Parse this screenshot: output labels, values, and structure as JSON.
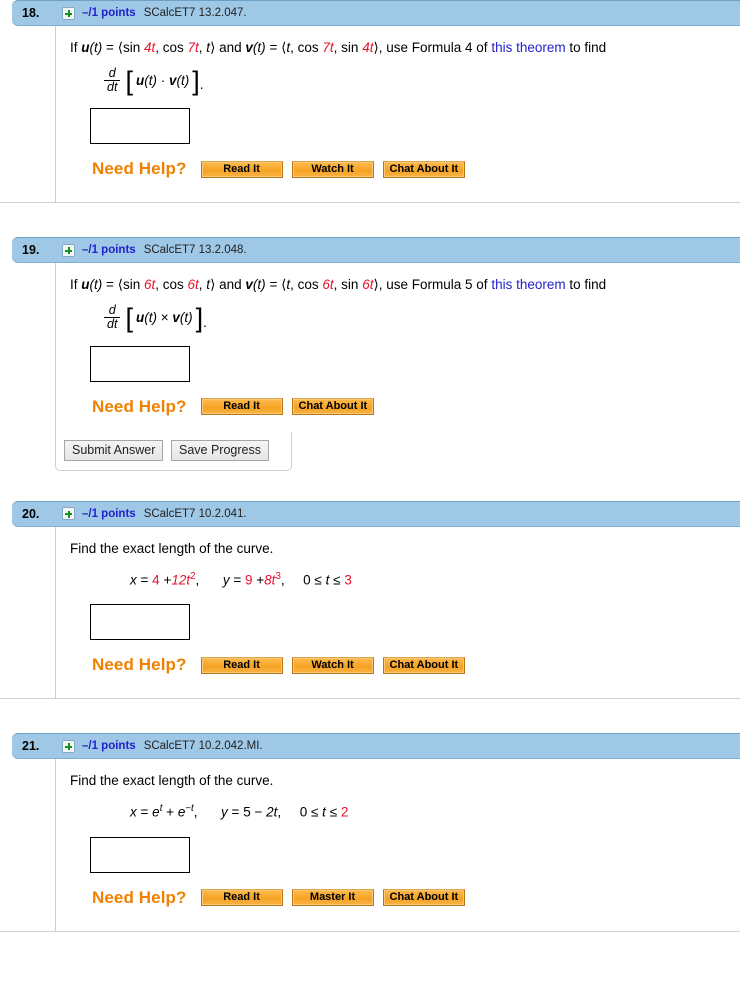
{
  "questions": [
    {
      "number": "18.",
      "points": "–/1 points",
      "code": "SCalcET7 13.2.047.",
      "icon": "plus-icon",
      "prompt": {
        "if": "If",
        "u_label": "u",
        "u_arg": "(t)",
        "eq": "=",
        "u_vec": "⟨sin 4t, cos 7t, t⟩",
        "and": "and",
        "v_label": "v",
        "v_arg": "(t)",
        "v_vec": "⟨t, cos 7t, sin 4t⟩,",
        "use": "use Formula 4 of",
        "link": "this theorem",
        "tofind": "to find"
      },
      "math": {
        "num": "d",
        "den": "dt",
        "open": "[",
        "inner": "u(t) · v(t)",
        "close": "]",
        "trail": "."
      },
      "answer_value": "",
      "help_label": "Need Help?",
      "help_buttons": [
        "Read It",
        "Watch It",
        "Chat About It"
      ]
    },
    {
      "number": "19.",
      "points": "–/1 points",
      "code": "SCalcET7 13.2.048.",
      "icon": "plus-icon",
      "prompt": {
        "if": "If",
        "u_label": "u",
        "u_arg": "(t)",
        "eq": "=",
        "u_vec": "⟨sin 6t, cos 6t, t⟩",
        "and": "and",
        "v_label": "v",
        "v_arg": "(t)",
        "v_vec": "⟨t, cos 6t, sin 6t⟩,",
        "use": "use Formula 5 of",
        "link": "this theorem",
        "tofind": "to find"
      },
      "math": {
        "num": "d",
        "den": "dt",
        "open": "[",
        "inner": "u(t) × v(t)",
        "close": "]",
        "trail": "."
      },
      "answer_value": "",
      "help_label": "Need Help?",
      "help_buttons": [
        "Read It",
        "Chat About It"
      ]
    },
    {
      "number": "20.",
      "points": "–/1 points",
      "code": "SCalcET7 10.2.041.",
      "icon": "plus-icon",
      "prompt_text": "Find the exact length of the curve.",
      "equation": {
        "x_lhs": "x",
        "x_eq": "=",
        "x_a": "4",
        "x_plus": "+",
        "x_b": "12t",
        "x_b_sup": "2",
        "x_comma": ",",
        "y_lhs": "y",
        "y_eq": "=",
        "y_a": "9",
        "y_plus": "+",
        "y_b": "8t",
        "y_b_sup": "3",
        "y_comma": ",",
        "domain_lo": "0",
        "domain_le1": "≤",
        "domain_var": "t",
        "domain_le2": "≤",
        "domain_hi": "3"
      },
      "answer_value": "",
      "help_label": "Need Help?",
      "help_buttons": [
        "Read It",
        "Watch It",
        "Chat About It"
      ]
    },
    {
      "number": "21.",
      "points": "–/1 points",
      "code": "SCalcET7 10.2.042.MI.",
      "icon": "plus-icon",
      "prompt_text": "Find the exact length of the curve.",
      "equation": {
        "x_lhs": "x",
        "x_eq": "=",
        "x_a": "e",
        "x_a_sup": "t",
        "x_plus": "+",
        "x_b": "e",
        "x_b_sup": "−t",
        "x_comma": ",",
        "y_lhs": "y",
        "y_eq": "=",
        "y_a": "5",
        "y_minus": "−",
        "y_b": "2t",
        "y_comma": ",",
        "domain_lo": "0",
        "domain_le1": "≤",
        "domain_var": "t",
        "domain_le2": "≤",
        "domain_hi": "2"
      },
      "answer_value": "",
      "help_label": "Need Help?",
      "help_buttons": [
        "Read It",
        "Master It",
        "Chat About It"
      ]
    }
  ],
  "submit_bar": {
    "submit_label": "Submit Answer",
    "save_label": "Save Progress"
  },
  "colors": {
    "header_bg": "#9ec8e6",
    "points_blue": "#2222cc",
    "link_blue": "#2222cc",
    "red": "#e8112d",
    "orange": "#f08000",
    "help_btn": "#f7a92e"
  }
}
